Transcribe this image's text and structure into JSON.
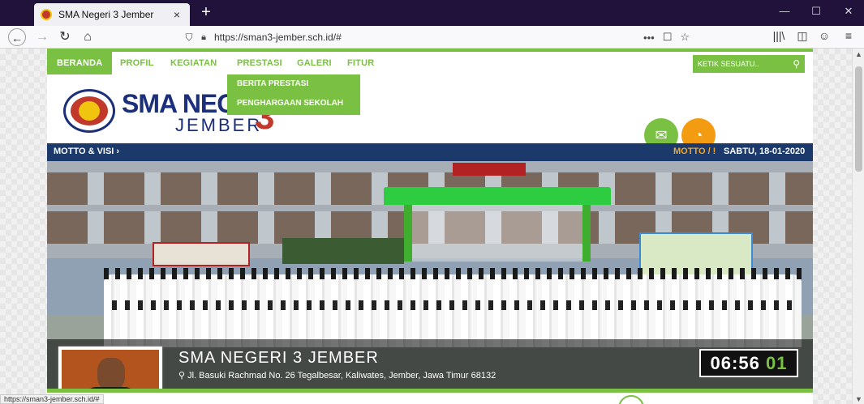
{
  "browser": {
    "tab_title": "SMA Negeri 3 Jember",
    "tab_close": "×",
    "new_tab": "+",
    "url": "https://sman3-jember.sch.id/#",
    "window_controls": [
      "—",
      "☐",
      "✕"
    ],
    "status_url": "https://sman3-jember.sch.id/#",
    "url_actions": [
      "•••",
      "☐",
      "☆"
    ],
    "toolbar_icons": [
      "|||\\",
      "◫",
      "☺",
      "≡"
    ]
  },
  "menu": {
    "items": [
      "BERANDA",
      "PROFIL",
      "KEGIATAN",
      "PRESTASI",
      "GALERI",
      "FITUR"
    ],
    "search_placeholder": "KETIK SESUATU..",
    "dropdown": [
      "BERITA PRESTASI",
      "PENGHARGAAN SEKOLAH"
    ]
  },
  "header": {
    "brand_line1": "SMA NEG",
    "brand_line2": "JEMBER",
    "brand_num": "3",
    "mail_icon": "mail-icon",
    "rss_icon": "rss-icon"
  },
  "ticker": {
    "motto_visi": "MOTTO & VISI ›",
    "motto": "MOTTO / !",
    "date": "SABTU, 18-01-2020"
  },
  "hero": {
    "school_name": "SMA NEGERI 3 JEMBER",
    "address": "Jl. Basuki Rachmad No. 26 Tegalbesar, Kaliwates, Jember, Jawa Timur 68132",
    "clock_hm": "06:56",
    "clock_s": "01"
  },
  "colors": {
    "green": "#7ac143",
    "navy": "#1b3a6b",
    "orange": "#f39c12"
  }
}
